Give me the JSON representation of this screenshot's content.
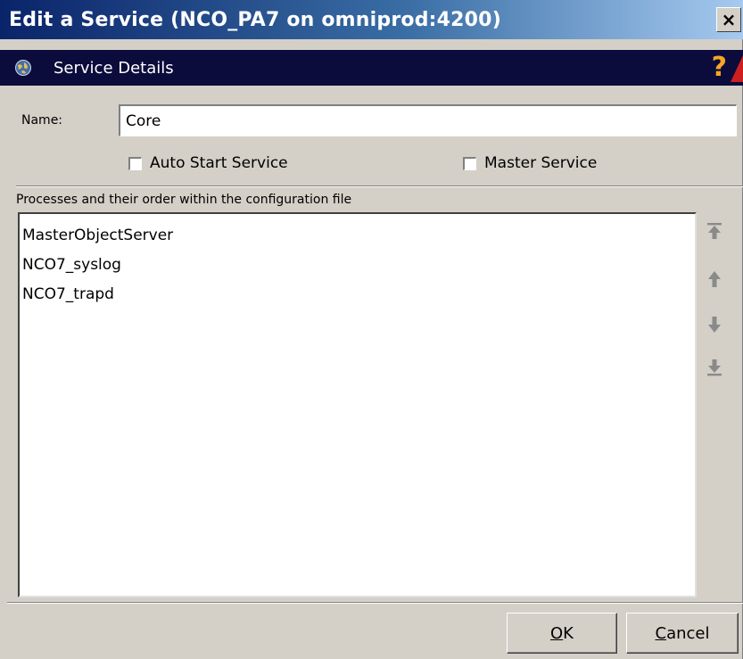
{
  "window": {
    "title": "Edit a Service (NCO_PA7 on omniprod:4200)",
    "close_label": "×"
  },
  "header": {
    "title": "Service Details",
    "help_label": "?"
  },
  "form": {
    "name_label": "Name:",
    "name_value": "Core",
    "auto_start_label": "Auto Start Service",
    "auto_start_checked": false,
    "master_label": "Master Service",
    "master_checked": false
  },
  "processes": {
    "section_title": "Processes and their order within the configuration file",
    "items": [
      "MasterObjectServer",
      "NCO7_syslog",
      "NCO7_trapd"
    ]
  },
  "order_buttons": [
    "move-to-top",
    "move-up",
    "move-down",
    "move-to-bottom"
  ],
  "buttons": {
    "ok_mnemonic": "O",
    "ok_rest": "K",
    "cancel_mnemonic": "C",
    "cancel_rest": "ancel"
  },
  "colors": {
    "title_gradient_start": "#0a246a",
    "title_gradient_end": "#a6caf0",
    "header_bg": "#0b0b3c",
    "dialog_bg": "#d4d0c8",
    "help_icon": "#f5a623",
    "arrow_icon": "#8a8a8a"
  }
}
